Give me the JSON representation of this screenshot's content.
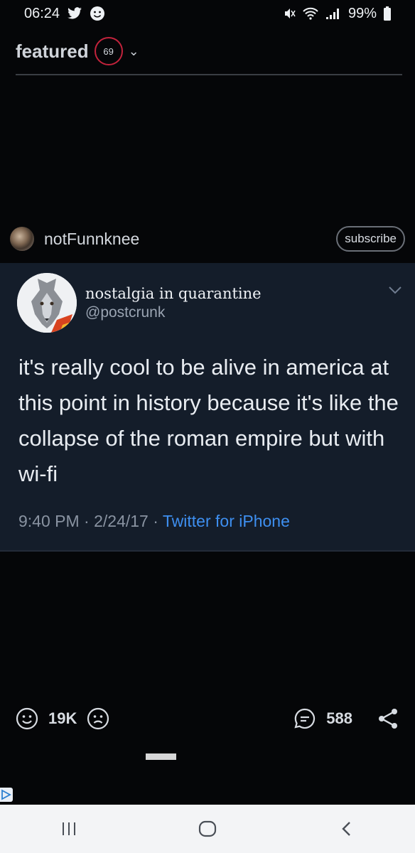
{
  "statusbar": {
    "time": "06:24",
    "battery": "99%",
    "icons": [
      "twitter-icon",
      "smiley-notification-icon",
      "mute-icon",
      "wifi-icon",
      "signal-icon",
      "battery-icon"
    ]
  },
  "header": {
    "title": "featured",
    "badge_count": "69",
    "dropdown_icon": "chevron-down-icon"
  },
  "post": {
    "author": "notFunnknee",
    "subscribe_label": "subscribe"
  },
  "tweet": {
    "display_name": "nostalgia in quarantine",
    "handle": "@postcrunk",
    "text": "it's really cool to be alive in america at this point in history because it's like the collapse of the roman empire but with wi-fi",
    "time": "9:40 PM",
    "date": "2/24/17",
    "source": "Twitter for iPhone",
    "separator": "·"
  },
  "actions": {
    "upvotes": "19K",
    "comments": "588",
    "icons": [
      "smile-icon",
      "frown-icon",
      "comment-icon",
      "share-icon"
    ]
  },
  "navbar": {
    "icons": [
      "recent-apps-icon",
      "home-icon",
      "back-icon"
    ]
  },
  "colors": {
    "background": "#050608",
    "tweet_card": "#141d2a",
    "badge_border": "#c2233c",
    "link": "#3e8ff0",
    "navbar": "#f3f4f6"
  }
}
